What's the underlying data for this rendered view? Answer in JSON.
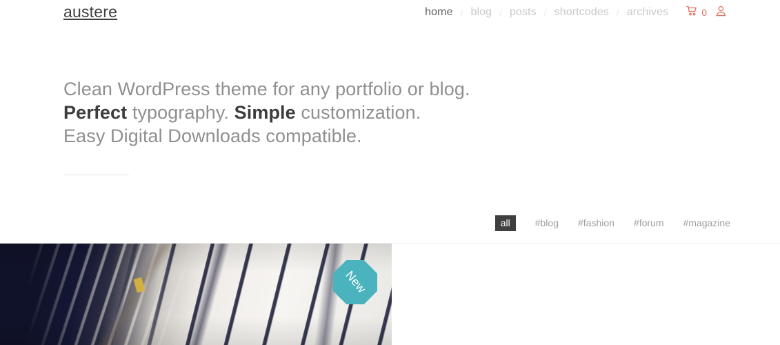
{
  "header": {
    "brand": "austere",
    "nav": [
      {
        "label": "home",
        "active": true
      },
      {
        "label": "blog",
        "active": false
      },
      {
        "label": "posts",
        "active": false
      },
      {
        "label": "shortcodes",
        "active": false
      },
      {
        "label": "archives",
        "active": false
      }
    ],
    "separator": "/",
    "cart": {
      "icon": "shopping-cart-icon",
      "count": "0"
    },
    "account": {
      "icon": "user-account-icon"
    },
    "accent_color": "#e4705c"
  },
  "hero": {
    "line1": "Clean WordPress theme for any portfolio or blog.",
    "line2_bold1": "Perfect",
    "line2_mid": " typography. ",
    "line2_bold2": "Simple",
    "line2_end": " customization.",
    "line3": "Easy Digital Downloads compatible."
  },
  "filters": {
    "items": [
      {
        "label": "all",
        "active": true
      },
      {
        "label": "#blog",
        "active": false
      },
      {
        "label": "#fashion",
        "active": false
      },
      {
        "label": "#forum",
        "active": false
      },
      {
        "label": "#magazine",
        "active": false
      }
    ],
    "active_bg": "#3f3f3f"
  },
  "grid": {
    "items": [
      {
        "badge": "New",
        "badge_color": "#4bb3bd",
        "image_alt": "bookshelf-architecture-photo"
      }
    ]
  }
}
